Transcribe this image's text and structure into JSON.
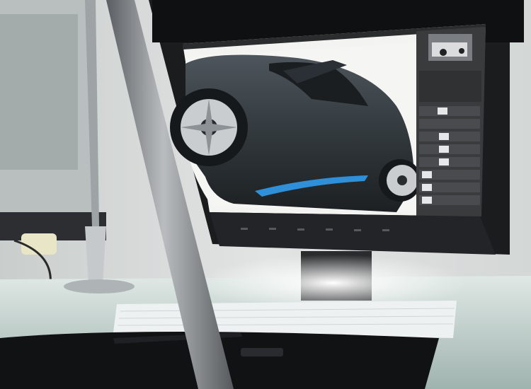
{
  "scene": {
    "description_tags": [
      "monitor",
      "photo-editing-app",
      "car-image",
      "keyboard",
      "desk-lamp",
      "drawing-tablet"
    ],
    "colors": {
      "wall": "#d9dcdb",
      "monitor_bezel": "#1b1c1e",
      "monitor_stand": "#2a2b2d",
      "canvas_bg": "#f3f3f2",
      "car_body": "#2e3438",
      "car_accent": "#2f8fd8",
      "panel_bg": "#3a3b3d",
      "panel_row": "#4a4b4e",
      "desk_glass": "#bfd0cc",
      "keyboard": "#eef1f1",
      "tablet": "#111214",
      "lamp_pole": "#7b7f83"
    },
    "icons": [
      "layer-thumbnail",
      "eye-icon",
      "navigator-thumbnail"
    ]
  }
}
